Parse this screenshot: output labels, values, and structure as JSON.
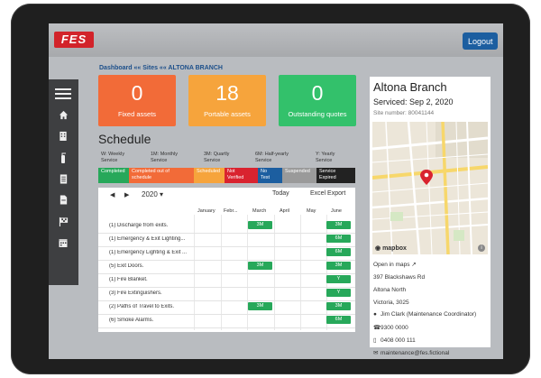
{
  "topbar": {
    "logo_text": "FES",
    "logout_label": "Logout"
  },
  "breadcrumb": {
    "dashboard": "Dashboard",
    "sep1": " «« ",
    "sites": "Sites",
    "sep2": " «« ",
    "current": "ALTONA BRANCH"
  },
  "cards": [
    {
      "value": "0",
      "label": "Fixed assets",
      "color": "#f26b38"
    },
    {
      "value": "18",
      "label": "Portable assets",
      "color": "#f6a43c"
    },
    {
      "value": "0",
      "label": "Outstanding quotes",
      "color": "#33c16b"
    }
  ],
  "schedule": {
    "title": "Schedule",
    "legend": [
      {
        "code": "W: Weekly",
        "desc": "Service"
      },
      {
        "code": "1M: Monthly",
        "desc": "Service"
      },
      {
        "code": "3M: Quartly",
        "desc": "Service"
      },
      {
        "code": "6M: Half-yearly",
        "desc": "Service"
      },
      {
        "code": "Y: Yearly",
        "desc": "Service"
      }
    ],
    "statuses": [
      {
        "line1": "Completed",
        "line2": "",
        "color": "#27a85a"
      },
      {
        "line1": "Completed out of",
        "line2": "schedule",
        "color": "#f26b38"
      },
      {
        "line1": "Scheduled",
        "line2": "",
        "color": "#f6a43c"
      },
      {
        "line1": "Not",
        "line2": "Verified",
        "color": "#d9232f"
      },
      {
        "line1": "No",
        "line2": "Test",
        "color": "#1c5ea0"
      },
      {
        "line1": "Suspended",
        "line2": "",
        "color": "#9a9a9a"
      },
      {
        "line1": "Service",
        "line2": "Expired",
        "color": "#222222"
      }
    ],
    "year": "2020",
    "today_label": "Today",
    "export_label": "Excel Export",
    "months": [
      "January",
      "Febr...",
      "March",
      "April",
      "May",
      "June"
    ],
    "rows": [
      {
        "label": "(1) Discharge from exits.",
        "march": "3M",
        "june": "3M"
      },
      {
        "label": "(1) Emergency & Exit Lighting...",
        "march": "",
        "june": "6M"
      },
      {
        "label": "(1) Emergency Lighting & Exit ...",
        "march": "",
        "june": "6M"
      },
      {
        "label": "(5) Exit Doors.",
        "march": "3M",
        "june": "3M"
      },
      {
        "label": "(1) Fire Blanket.",
        "march": "",
        "june": "Y"
      },
      {
        "label": "(3) Fire Extinguishers.",
        "march": "",
        "june": "Y"
      },
      {
        "label": "(2) Paths of Travel to Exits.",
        "march": "3M",
        "june": "3M"
      },
      {
        "label": "(6) Smoke Alarms.",
        "march": "",
        "june": "6M"
      }
    ]
  },
  "branch": {
    "title": "Altona Branch",
    "serviced": "Serviced: Sep 2, 2020",
    "site_number": "Site number: 80041144",
    "map_attribution": "mapbox",
    "open_in_maps": "Open in maps",
    "address_line1": "397 Blackshaws Rd",
    "address_line2": "Altona North",
    "address_line3": "Victoria, 3025",
    "contact": "Jim Clark (Maintenance Coordinator)",
    "phone": "9300 0000",
    "mobile": "0408 000 111",
    "email": "maintenance@fes.fictional"
  }
}
